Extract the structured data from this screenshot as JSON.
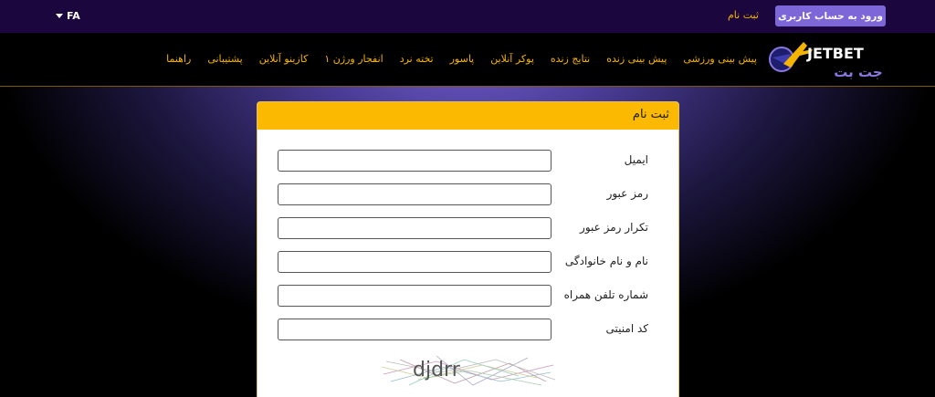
{
  "topbar": {
    "language": "FA",
    "register_link": "ثبت نام",
    "login_button": "ورود به حساب کاربری"
  },
  "logo": {
    "latin": "JETBET",
    "persian": "جت بت"
  },
  "nav": {
    "items": [
      "پیش بینی ورزشی",
      "پیش بینی زنده",
      "نتایج زنده",
      "پوکر آنلاین",
      "پاسور",
      "تخته نرد",
      "انفجار ورژن ۱",
      "کازینو آنلاین",
      "پشتیبانی",
      "راهنما"
    ]
  },
  "form": {
    "title": "ثبت نام",
    "fields": {
      "email": {
        "label": "ایمیل",
        "value": ""
      },
      "password": {
        "label": "رمز عبور",
        "value": ""
      },
      "password_confirm": {
        "label": "تکرار رمز عبور",
        "value": ""
      },
      "full_name": {
        "label": "نام و نام خانوادگی",
        "value": ""
      },
      "phone": {
        "label": "شماره تلفن همراه",
        "value": ""
      },
      "security_code": {
        "label": "کد امنیتی",
        "value": ""
      }
    },
    "captcha_text": "djdrr"
  },
  "colors": {
    "accent_yellow": "#fbb902",
    "login_button": "#7d67d8",
    "topbar": "#1c063e"
  }
}
